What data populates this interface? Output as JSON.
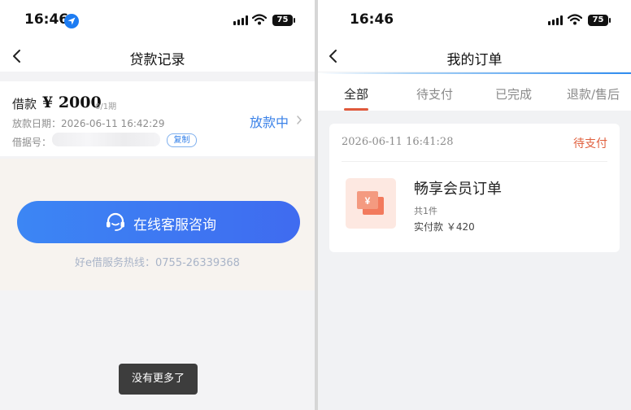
{
  "left_screen": {
    "status_bar": {
      "time": "16:46",
      "battery": "75"
    },
    "nav": {
      "title": "贷款记录"
    },
    "loan": {
      "label": "借款",
      "amount": "¥ 2000",
      "period": "0/1期",
      "date": "放款日期：2026-06-11 16:42:29",
      "number_label": "借据号：",
      "copy_label": "复制",
      "status": "放款中"
    },
    "customer_service": {
      "button_label": "在线客服咨询",
      "hotline": "好e借服务热线：0755-26339368"
    },
    "toast": "没有更多了"
  },
  "right_screen": {
    "status_bar": {
      "time": "16:46",
      "battery": "75"
    },
    "nav": {
      "title": "我的订单"
    },
    "tabs": [
      {
        "label": "全部",
        "active": true
      },
      {
        "label": "待支付",
        "active": false
      },
      {
        "label": "已完成",
        "active": false
      },
      {
        "label": "退款/售后",
        "active": false
      }
    ],
    "order": {
      "date": "2026-06-11 16:41:28",
      "status": "待支付",
      "name": "畅享会员订单",
      "count": "共1件",
      "paid": "实付款 ￥420"
    }
  },
  "colors": {
    "primary_blue": "#3b82e8",
    "accent_orange": "#e0603e",
    "cs_button_gradient_start": "#3c86f4",
    "cs_button_gradient_end": "#3f6bf0"
  },
  "icons": [
    "location-arrow-icon",
    "signal-icon",
    "wifi-icon",
    "battery-icon",
    "back-chevron-icon",
    "chevron-right-icon",
    "headset-icon",
    "voucher-icon"
  ]
}
